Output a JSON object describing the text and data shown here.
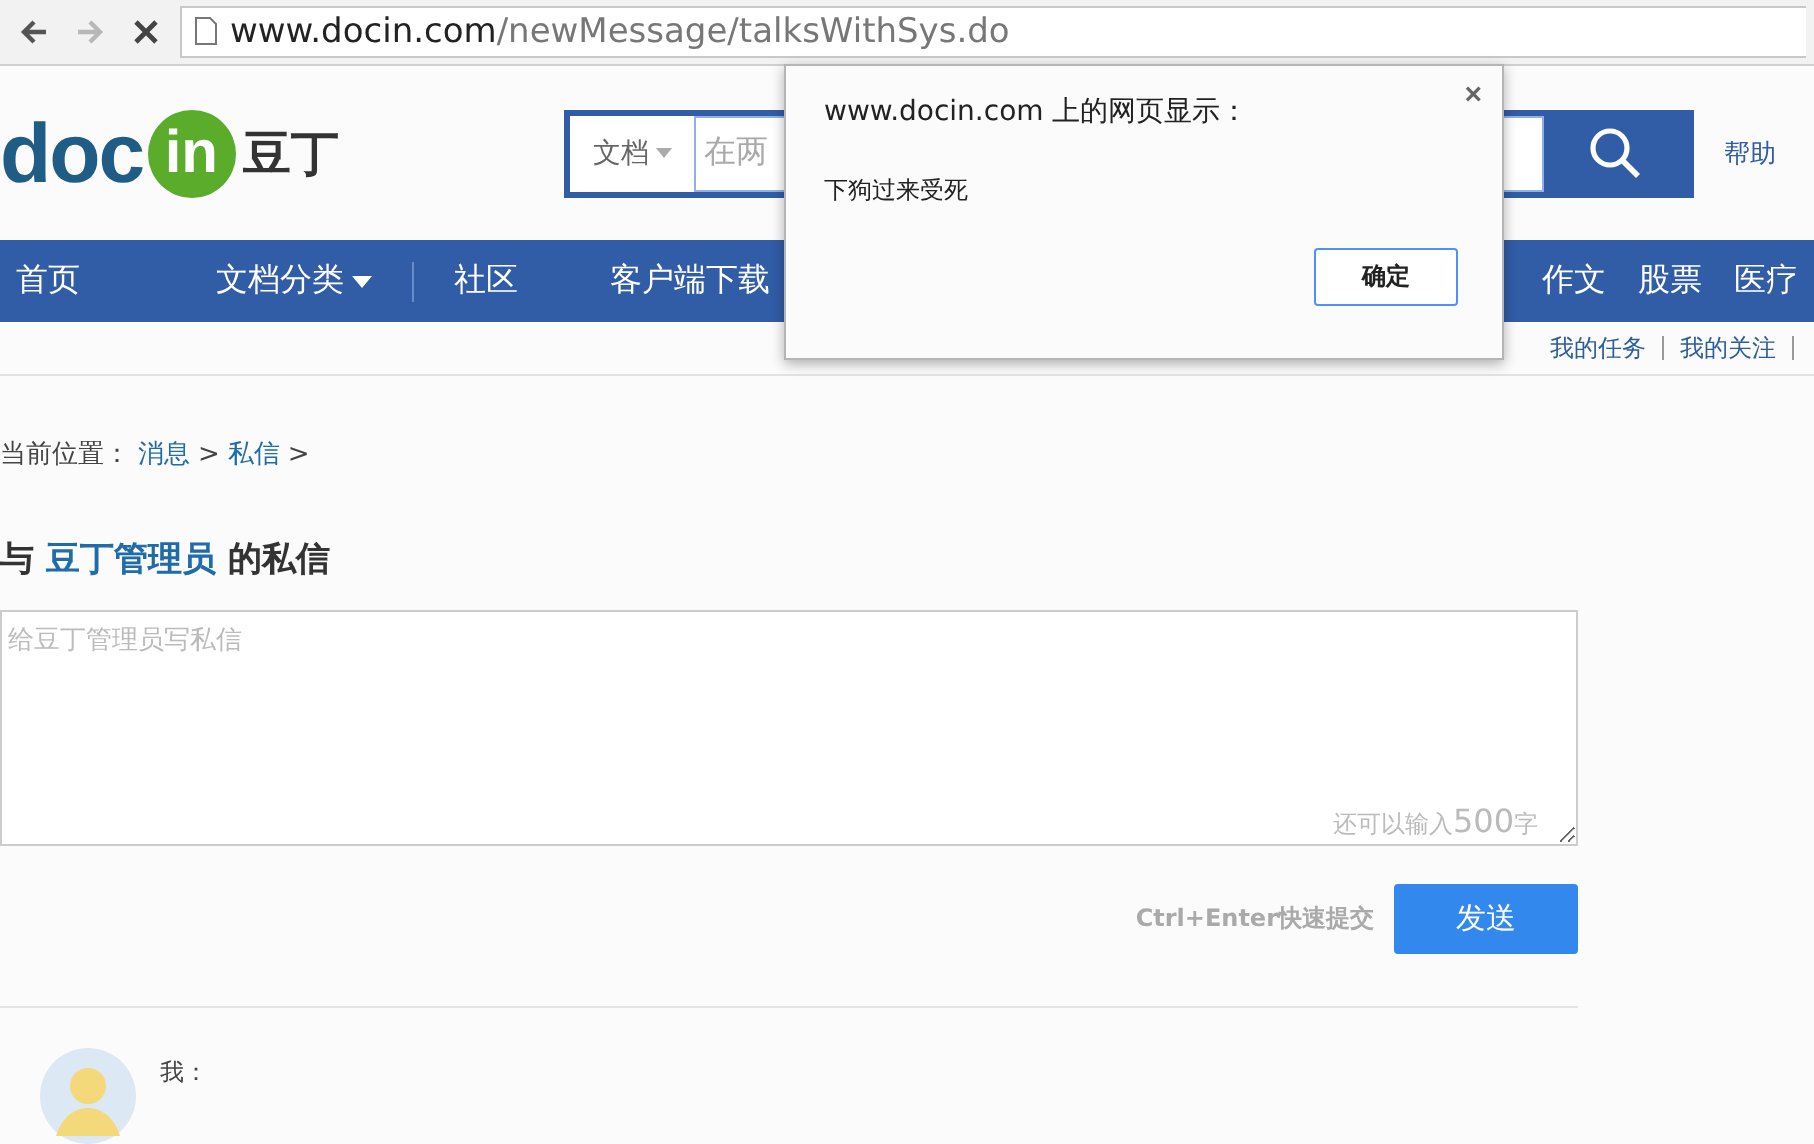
{
  "browser": {
    "back_disabled": false,
    "forward_disabled": true,
    "url_host": "www.docin.com",
    "url_path": "/newMessage/talksWithSys.do"
  },
  "header": {
    "logo_left": "doc",
    "logo_badge": "in",
    "logo_cn": "豆丁",
    "search_scope": "文档",
    "search_placeholder": "在两",
    "help": "帮助"
  },
  "nav": {
    "left": [
      {
        "label": "首页",
        "dropdown": false
      },
      {
        "label": "文档分类",
        "dropdown": true
      },
      {
        "label": "社区",
        "dropdown": false
      },
      {
        "label": "客户端下载",
        "dropdown": false
      }
    ],
    "right": [
      {
        "label": "作文",
        "dropdown": false
      },
      {
        "label": "股票",
        "dropdown": false
      },
      {
        "label": "医疗",
        "dropdown": false
      }
    ]
  },
  "sub_links": [
    "我的任务",
    "我的关注"
  ],
  "breadcrumb": {
    "prefix": "当前位置：",
    "items": [
      "消息",
      "私信"
    ],
    "separator": ">"
  },
  "title": {
    "prefix": "与",
    "name": "豆丁管理员",
    "suffix": "的私信"
  },
  "composer": {
    "placeholder": "给豆丁管理员写私信",
    "counter_prefix": "还可以输入",
    "count": "500",
    "counter_suffix": "字",
    "hint": "Ctrl+Enter快速提交",
    "send": "发送"
  },
  "message": {
    "author": "我："
  },
  "dialog": {
    "title": "www.docin.com 上的网页显示：",
    "close": "×",
    "text": "下狗过来受死",
    "ok": "确定"
  }
}
